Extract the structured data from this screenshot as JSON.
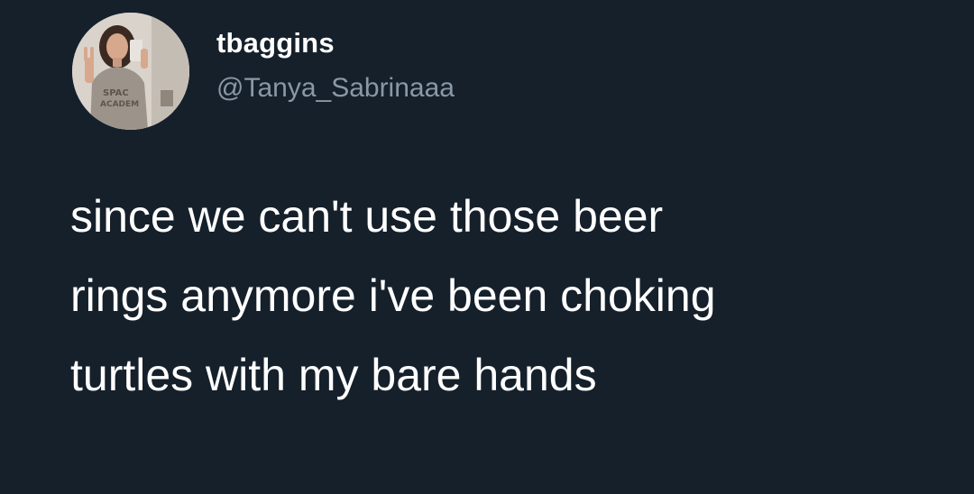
{
  "colors": {
    "background": "#15202b",
    "text_primary": "#ffffff",
    "text_secondary": "#8b98a5"
  },
  "author": {
    "display_name": "tbaggins",
    "handle": "@Tanya_Sabrinaaa",
    "avatar_icon": "profile-photo-avatar"
  },
  "tweet": {
    "lines": [
      "since we can't use those beer",
      "rings anymore i've been choking",
      "turtles with my bare hands"
    ]
  }
}
